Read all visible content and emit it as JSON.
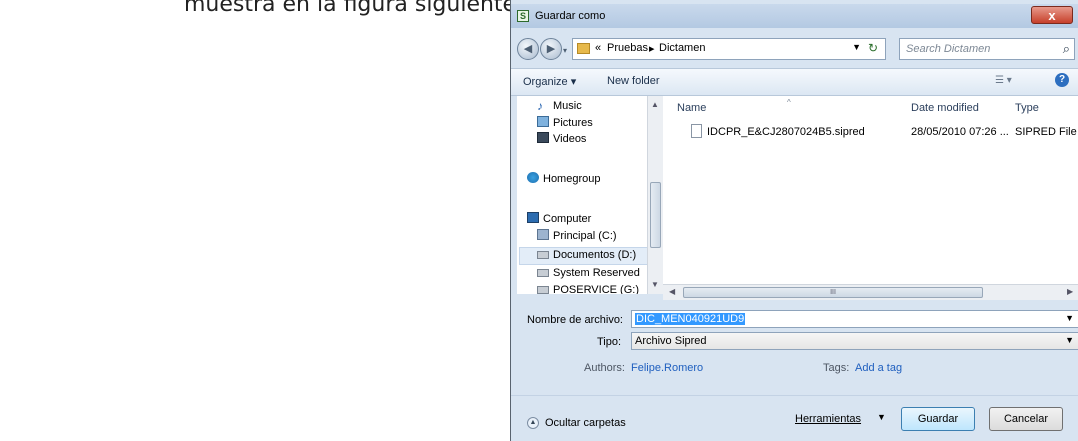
{
  "document": {
    "caption_fragment": "muestra en la figura siguiente:"
  },
  "dialog": {
    "title": "Guardar como",
    "close_label": "x",
    "address": {
      "parent": "Pruebas",
      "current": "Dictamen",
      "prefix": "«"
    },
    "search": {
      "placeholder": "Search Dictamen"
    },
    "toolbar": {
      "organize": "Organize ▾",
      "new_folder": "New folder"
    },
    "nav": {
      "items": [
        {
          "label": "Music",
          "icon": "music-icon"
        },
        {
          "label": "Pictures",
          "icon": "pictures-icon"
        },
        {
          "label": "Videos",
          "icon": "videos-icon"
        },
        {
          "label": "Homegroup",
          "icon": "homegroup-icon"
        },
        {
          "label": "Computer",
          "icon": "computer-icon"
        },
        {
          "label": "Principal (C:)",
          "icon": "drive-icon"
        },
        {
          "label": "Documentos (D:)",
          "icon": "drive-icon"
        },
        {
          "label": "System Reserved",
          "icon": "drive-icon"
        },
        {
          "label": "POSERVICE (G:)",
          "icon": "drive-icon"
        }
      ]
    },
    "columns": {
      "name": "Name",
      "date": "Date modified",
      "type": "Type"
    },
    "files": [
      {
        "name": "IDCPR_E&CJ2807024B5.sipred",
        "date": "28/05/2010 07:26 ...",
        "type": "SIPRED File"
      }
    ],
    "scroll_grip": "III",
    "form": {
      "filename_label": "Nombre de archivo:",
      "filename_value": "DIC_MEN040921UD9",
      "type_label": "Tipo:",
      "type_value": "Archivo Sipred",
      "authors_label": "Authors:",
      "authors_value": "Felipe.Romero",
      "tags_label": "Tags:",
      "tags_value": "Add a tag"
    },
    "footer": {
      "hide_folders": "Ocultar carpetas",
      "tools": "Herramientas",
      "save": "Guardar",
      "cancel": "Cancelar"
    }
  }
}
